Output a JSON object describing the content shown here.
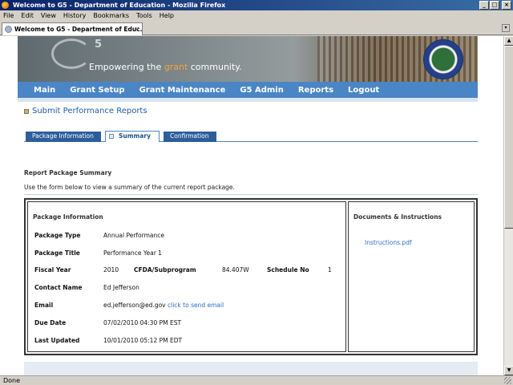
{
  "window": {
    "title": "Welcome to G5 - Department of Education - Mozilla Firefox"
  },
  "menu": [
    "File",
    "Edit",
    "View",
    "History",
    "Bookmarks",
    "Tools",
    "Help"
  ],
  "browser_tab": {
    "title": "Welcome to G5 - Department of Educ..."
  },
  "banner": {
    "tagline_prefix": "Empowering the ",
    "tagline_accent": "grant",
    "tagline_suffix": " community.",
    "g5_superscript": "5",
    "accent_color": "#f3a23a"
  },
  "nav": [
    "Main",
    "Grant Setup",
    "Grant Maintenance",
    "G5 Admin",
    "Reports",
    "Logout"
  ],
  "page": {
    "heading": "Submit Performance Reports",
    "tabs": [
      {
        "label": "Package Information",
        "active": false
      },
      {
        "label": "Summary",
        "active": true
      },
      {
        "label": "Confirmation",
        "active": false
      }
    ],
    "section_title": "Report Package Summary",
    "section_desc": "Use the form below to view a summary of the current report package."
  },
  "package": {
    "panel_title": "Package Information",
    "package_type_label": "Package Type",
    "package_type": "Annual Performance",
    "package_title_label": "Package Title",
    "package_title": "Performance Year 1",
    "fiscal_year_label": "Fiscal Year",
    "fiscal_year": "2010",
    "cfda_label": "CFDA/Subprogram",
    "cfda": "84.407W",
    "schedule_label": "Schedule No",
    "schedule": "1",
    "contact_label": "Contact Name",
    "contact": "Ed Jefferson",
    "email_label": "Email",
    "email": "ed.jefferson@ed.gov",
    "email_link": "click to send email",
    "due_label": "Due Date",
    "due": "07/02/2010 04:30 PM EST",
    "updated_label": "Last Updated",
    "updated": "10/01/2010 05:12 PM EDT"
  },
  "documents": {
    "panel_title": "Documents & Instructions",
    "link": "Instructions.pdf"
  },
  "status": "Done",
  "colors": {
    "nav_bg": "#4a86c5",
    "tab_inactive": "#2c5e9c",
    "link": "#2a6fbf",
    "heading": "#1f5ca0"
  }
}
